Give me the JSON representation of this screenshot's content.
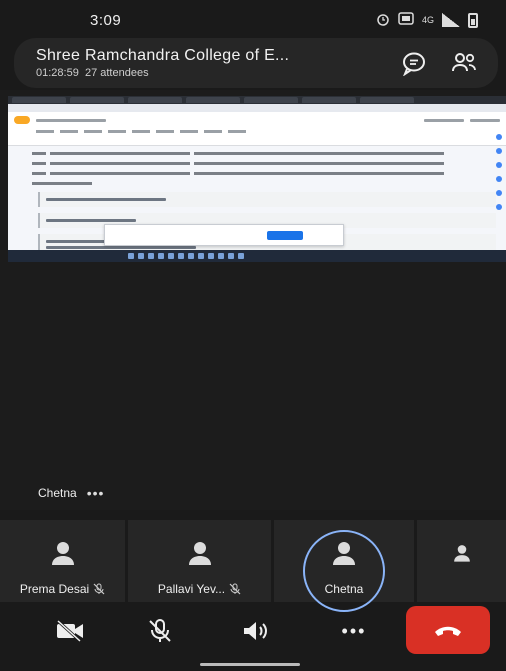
{
  "status_bar": {
    "time": "3:09",
    "network": "4G"
  },
  "meeting": {
    "title": "Shree Ramchandra College of E...",
    "duration": "01:28:59",
    "attendees": "27 attendees"
  },
  "speaker": {
    "name": "Chetna",
    "more": "•••"
  },
  "participants": [
    {
      "name": "Prema Desai",
      "muted": true
    },
    {
      "name": "Pallavi Yev...",
      "muted": true
    },
    {
      "name": "Chetna",
      "muted": false,
      "speaking": true
    },
    {
      "name": "",
      "muted": false
    }
  ],
  "controls": {
    "more": "•••"
  },
  "colors": {
    "end_call": "#d93025",
    "speaking_ring": "#8ab4f8",
    "background": "#1a1a1a"
  }
}
